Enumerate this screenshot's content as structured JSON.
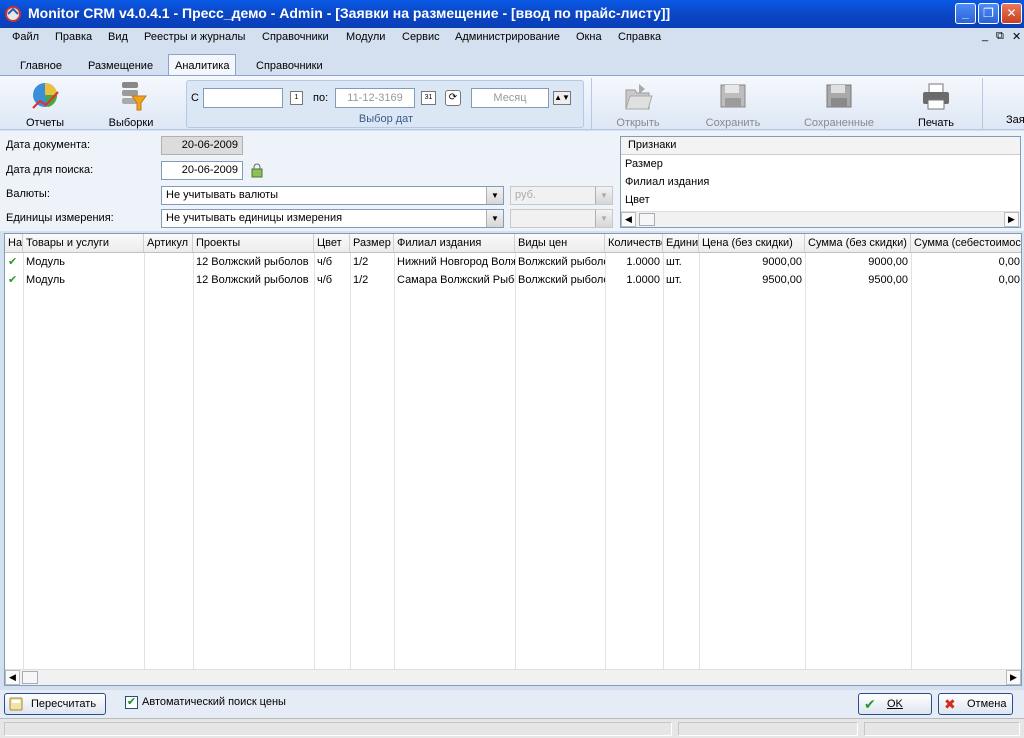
{
  "window": {
    "title": "Monitor CRM v4.0.4.1 - Пресс_демо - Admin - [Заявки на размещение - [ввод по прайс-листу]]",
    "buttons": [
      "_",
      "❐",
      "✕"
    ]
  },
  "menu": {
    "items": [
      "Файл",
      "Правка",
      "Вид",
      "Реестры и журналы",
      "Справочники",
      "Модули",
      "Сервис",
      "Администрирование",
      "Окна",
      "Справка"
    ],
    "right_controls": [
      "_",
      "⧉",
      "✕"
    ]
  },
  "tabs": [
    "Главное",
    "Размещение",
    "Аналитика",
    "Справочники"
  ],
  "active_tab": 2,
  "ribbon": {
    "reports_label": "Отчеты",
    "selections_label": "Выборки",
    "date_group": {
      "from_label": "С",
      "from_value": "",
      "to_label": "по:",
      "to_value": "11-12-3169",
      "period_value": "Месяц",
      "group_label": "Выбор дат"
    },
    "open_label": "Открыть",
    "save_label": "Сохранить",
    "saved_label": "Сохраненные",
    "print_label": "Печать",
    "cut_label": "Зая"
  },
  "form": {
    "doc_date_label": "Дата документа:",
    "doc_date_value": "20-06-2009",
    "search_date_label": "Дата для поиска:",
    "search_date_value": "20-06-2009",
    "currency_label": "Валюты:",
    "currency_value": "Не учитывать валюты",
    "currency_unit": "руб.",
    "units_label": "Единицы измерения:",
    "units_value": "Не учитывать единицы измерения",
    "units_extra": ""
  },
  "attributes": {
    "header": "Признаки",
    "items": [
      "Размер",
      "Филиал издания",
      "Цвет"
    ]
  },
  "grid": {
    "columns": [
      "На",
      "Товары и услуги",
      "Артикул",
      "Проекты",
      "Цвет",
      "Размер",
      "Филиал издания",
      "Виды цен",
      "Количество",
      "Единица",
      "Цена (без скидки)",
      "Сумма (без скидки)",
      "Сумма (себестоимость)"
    ],
    "rows": [
      [
        "✔",
        "Модуль",
        "",
        "12 Волжский рыболов",
        "ч/б",
        "1/2",
        "Нижний Новгород Волжский рыболов",
        "Волжский рыболов",
        "1.0000",
        "шт.",
        "9000,00",
        "9000,00",
        "0,00"
      ],
      [
        "✔",
        "Модуль",
        "",
        "12 Волжский рыболов",
        "ч/б",
        "1/2",
        "Самара Волжский Рыболов",
        "Волжский рыболов",
        "1.0000",
        "шт.",
        "9500,00",
        "9500,00",
        "0,00"
      ]
    ]
  },
  "bottom": {
    "recalc_label": "Пересчитать",
    "auto_search_label": "Автоматический поиск цены",
    "auto_search_checked": true,
    "ok_label": "OK",
    "cancel_label": "Отмена"
  }
}
